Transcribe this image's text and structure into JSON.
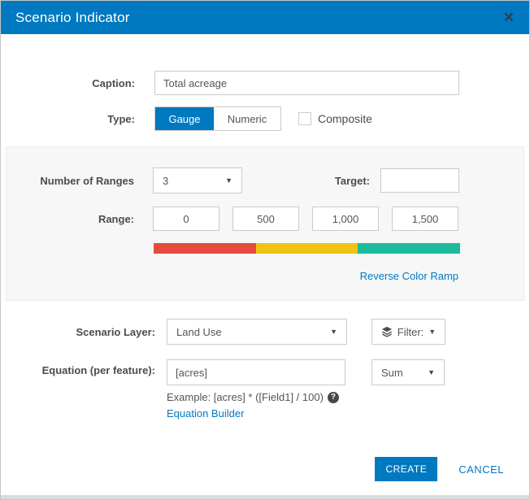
{
  "header": {
    "title": "Scenario Indicator"
  },
  "icons": {
    "close": "✕",
    "chevron_down": "▼",
    "help": "?"
  },
  "form": {
    "caption": {
      "label": "Caption:",
      "value": "Total acreage"
    },
    "type": {
      "label": "Type:",
      "options": [
        {
          "label": "Gauge",
          "selected": true
        },
        {
          "label": "Numeric",
          "selected": false
        }
      ],
      "composite": {
        "label": "Composite",
        "checked": false
      }
    },
    "ranges": {
      "number_label": "Number of Ranges",
      "number_value": "3",
      "target_label": "Target:",
      "target_value": "",
      "range_label": "Range:",
      "range_values": [
        "0",
        "500",
        "1,000",
        "1,500"
      ],
      "ramp_colors": [
        "#e64c3c",
        "#efc414",
        "#1dbb9b"
      ],
      "reverse_link": "Reverse Color Ramp"
    },
    "layer": {
      "label": "Scenario Layer:",
      "value": "Land Use",
      "filter_label": "Filter:"
    },
    "equation": {
      "label": "Equation (per feature):",
      "value": "[acres]",
      "example": "Example: [acres] * ([Field1] / 100)",
      "builder_link": "Equation Builder",
      "aggregation": "Sum"
    }
  },
  "footer": {
    "create_label": "CREATE",
    "cancel_label": "CANCEL"
  },
  "colors": {
    "accent_blue": "#0079c1",
    "panel_gray": "#f7f7f7"
  }
}
